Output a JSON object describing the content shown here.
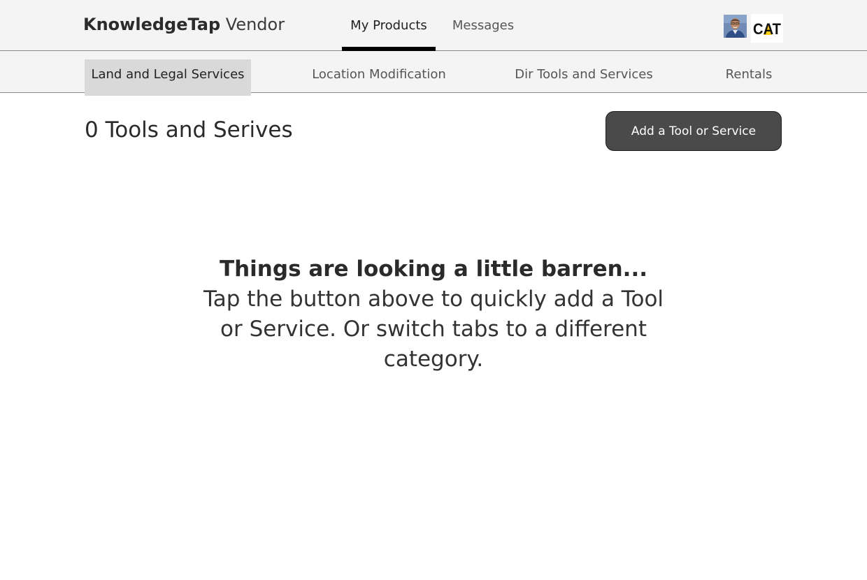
{
  "header": {
    "brand_bold": "KnowledgeTap",
    "brand_light": " Vendor",
    "nav": [
      {
        "label": "My Products",
        "active": true
      },
      {
        "label": "Messages",
        "active": false
      }
    ],
    "cat_logo_text": "CAT",
    "colors": {
      "cat_yellow": "#ffcd11",
      "nav_underline": "#000000"
    }
  },
  "categories": [
    {
      "label": "Land and Legal Services",
      "active": true
    },
    {
      "label": "Location Modification",
      "active": false
    },
    {
      "label": "Dir Tools and Services",
      "active": false
    },
    {
      "label": "Rentals",
      "active": false
    }
  ],
  "main": {
    "title": "0 Tools and Serives",
    "add_button_label": "Add a Tool or Service",
    "empty_title": "Things are looking a little barren...",
    "empty_body": "Tap the button above to quickly add a Tool or Service. Or switch tabs to a different category."
  }
}
